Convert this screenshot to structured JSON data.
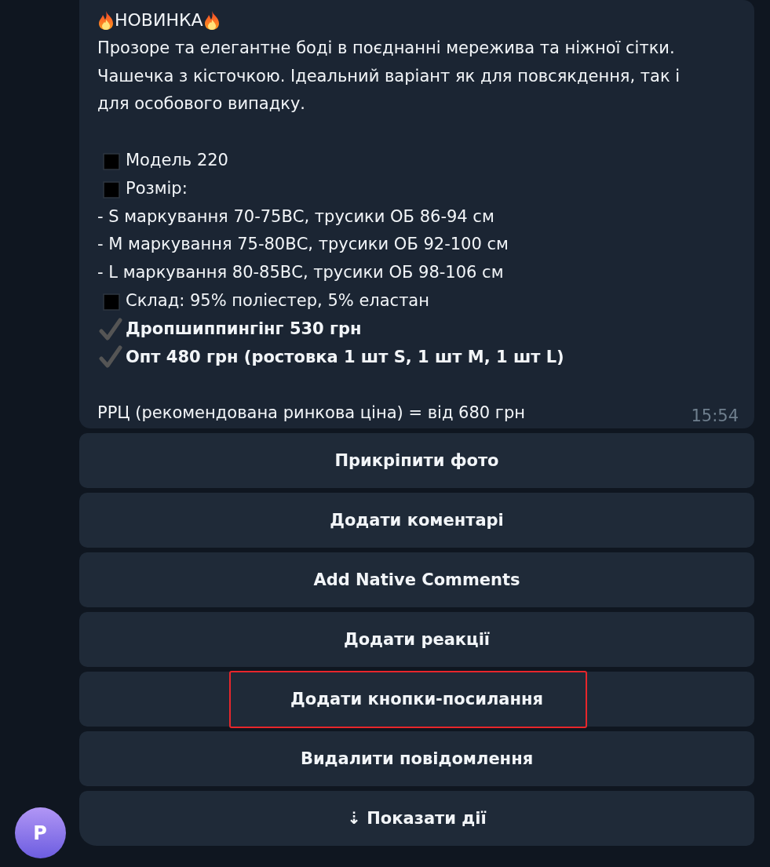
{
  "message": {
    "lines": [
      {
        "kind": "heading",
        "text": "НОВИНКА"
      },
      {
        "kind": "paragraph",
        "text": "Прозоре та елегантне боді в поєднанні мережива та ніжної сітки. Чашечка з кісточкою. Ідеальний варіант як для повсякдення, так і для особового випадку."
      },
      {
        "kind": "blank"
      },
      {
        "kind": "square",
        "text": "Модель 220"
      },
      {
        "kind": "square",
        "text": "Розмір:"
      },
      {
        "kind": "plain",
        "text": "- S маркування 70-75ВС, трусики ОБ 86-94 см"
      },
      {
        "kind": "plain",
        "text": "- M маркування 75-80ВС, трусики ОБ 92-100 см"
      },
      {
        "kind": "plain",
        "text": "- L маркування 80-85ВС, трусики ОБ 98-106 см"
      },
      {
        "kind": "square",
        "text": "Склад: 95% поліестер, 5% еластан"
      },
      {
        "kind": "check",
        "text": "Дропшиппингінг 530 грн"
      },
      {
        "kind": "check",
        "text": "Опт 480 грн (ростовка 1 шт S, 1 шт M, 1 шт L)"
      },
      {
        "kind": "blank"
      },
      {
        "kind": "plain",
        "text": "РРЦ (рекомендована ринкова ціна) = від 680 грн"
      }
    ],
    "time": "15:54"
  },
  "buttons": [
    {
      "label": "Прикріпити фото",
      "highlighted": false
    },
    {
      "label": "Додати коментарі",
      "highlighted": false
    },
    {
      "label": "Add Native Comments",
      "highlighted": false
    },
    {
      "label": "Додати реакції",
      "highlighted": false
    },
    {
      "label": "Додати кнопки-посилання",
      "highlighted": true
    },
    {
      "label": "Видалити повідомлення",
      "highlighted": false
    },
    {
      "label": "⇣ Показати дії",
      "highlighted": false
    }
  ],
  "avatar": {
    "letter": "P"
  }
}
